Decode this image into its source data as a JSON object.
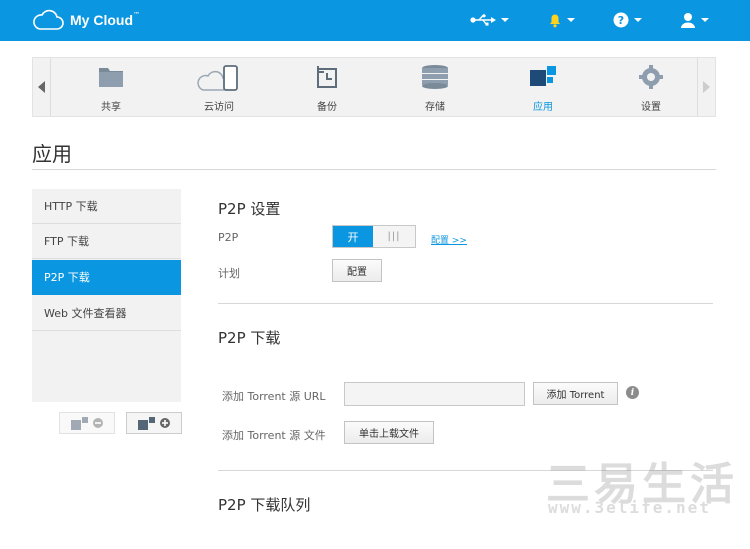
{
  "header": {
    "brand": "My Cloud",
    "brand_mark": "™",
    "accent": "#0a96e0",
    "icons": [
      "usb-icon",
      "bell-icon",
      "help-icon",
      "user-icon"
    ]
  },
  "nav": {
    "items": [
      {
        "label": "共享",
        "icon": "share-folder-icon"
      },
      {
        "label": "云访问",
        "icon": "cloud-device-icon"
      },
      {
        "label": "备份",
        "icon": "backup-icon"
      },
      {
        "label": "存储",
        "icon": "storage-icon"
      },
      {
        "label": "应用",
        "icon": "apps-icon"
      },
      {
        "label": "设置",
        "icon": "gear-icon"
      }
    ],
    "active": "应用"
  },
  "page": {
    "title": "应用"
  },
  "sidebar": {
    "items": [
      {
        "label": "HTTP 下载"
      },
      {
        "label": "FTP 下载"
      },
      {
        "label": "P2P 下载"
      },
      {
        "label": "Web 文件查看器"
      }
    ],
    "active": "P2P 下载"
  },
  "settings": {
    "title": "P2P 设置",
    "p2p_label": "P2P",
    "toggle_on": "开",
    "toggle_off": "|||",
    "config_link": "配置 >>",
    "schedule_label": "计划",
    "config_button": "配置"
  },
  "download": {
    "title": "P2P 下载",
    "url_label": "添加 Torrent 源 URL",
    "url_value": "",
    "add_button": "添加 Torrent",
    "file_label": "添加 Torrent 源 文件",
    "upload_button": "单击上载文件"
  },
  "queue": {
    "title": "P2P 下载队列"
  },
  "watermark": {
    "text": "三易生活",
    "url": "www.3elife.net"
  }
}
